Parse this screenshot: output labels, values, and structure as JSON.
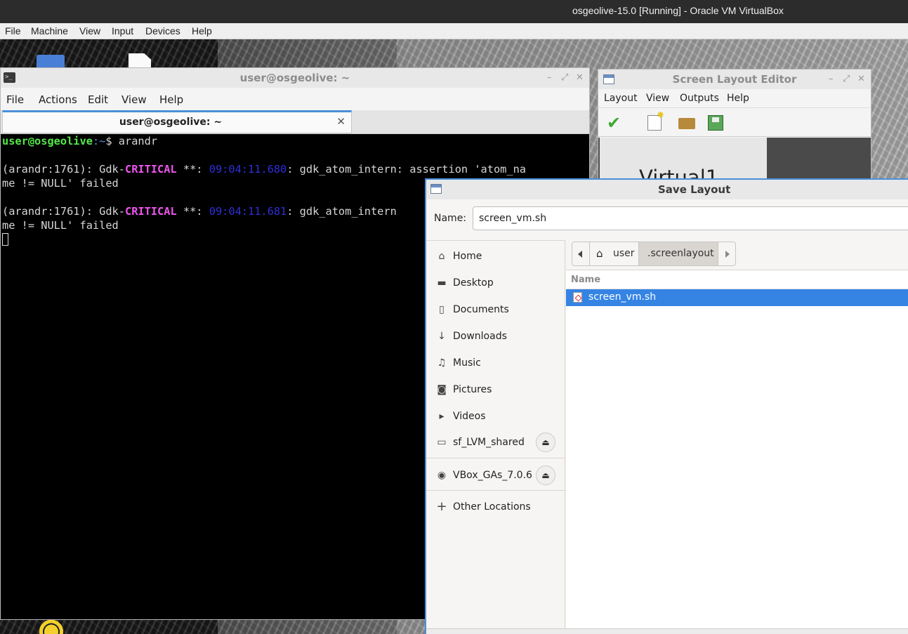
{
  "host": {
    "title": "osgeolive-15.0 [Running] - Oracle VM VirtualBox",
    "menu": [
      "File",
      "Machine",
      "View",
      "Input",
      "Devices",
      "Help"
    ]
  },
  "terminal": {
    "title": "user@osgeolive: ~",
    "menu": [
      "File",
      "Actions",
      "Edit",
      "View",
      "Help"
    ],
    "tab_label": "user@osgeolive: ~",
    "prompt_user": "user@osgeolive",
    "prompt_path": ":~",
    "prompt_symbol": "$ ",
    "command": "arandr",
    "errors": [
      {
        "prefix": "(arandr:1761): Gdk-",
        "level": "CRITICAL",
        "mid": " **: ",
        "time": "09:04:11.680",
        "message": ": gdk_atom_intern: assertion 'atom_na",
        "wrap": "me != NULL' failed"
      },
      {
        "prefix": "(arandr:1761): Gdk-",
        "level": "CRITICAL",
        "mid": " **: ",
        "time": "09:04:11.681",
        "message": ": gdk_atom_intern",
        "wrap": "me != NULL' failed"
      }
    ]
  },
  "layout_editor": {
    "title": "Screen Layout Editor",
    "menu": [
      "Layout",
      "View",
      "Outputs",
      "Help"
    ],
    "output_label": "Virtual1"
  },
  "save_dialog": {
    "title": "Save Layout",
    "name_label": "Name:",
    "name_value": "screen_vm.sh",
    "places": [
      {
        "label": "Home",
        "icon": "home-icon"
      },
      {
        "label": "Desktop",
        "icon": "folder-icon"
      },
      {
        "label": "Documents",
        "icon": "document-icon"
      },
      {
        "label": "Downloads",
        "icon": "download-icon"
      },
      {
        "label": "Music",
        "icon": "music-icon"
      },
      {
        "label": "Pictures",
        "icon": "camera-icon"
      },
      {
        "label": "Videos",
        "icon": "video-icon"
      }
    ],
    "devices": [
      {
        "label": "sf_LVM_shared",
        "icon": "drive-icon"
      },
      {
        "label": "VBox_GAs_7.0.6",
        "icon": "disc-icon"
      }
    ],
    "other_locations": "Other Locations",
    "path": [
      "user",
      ".screenlayout"
    ],
    "column_name": "Name",
    "files": [
      {
        "name": "screen_vm.sh",
        "selected": true
      }
    ]
  }
}
